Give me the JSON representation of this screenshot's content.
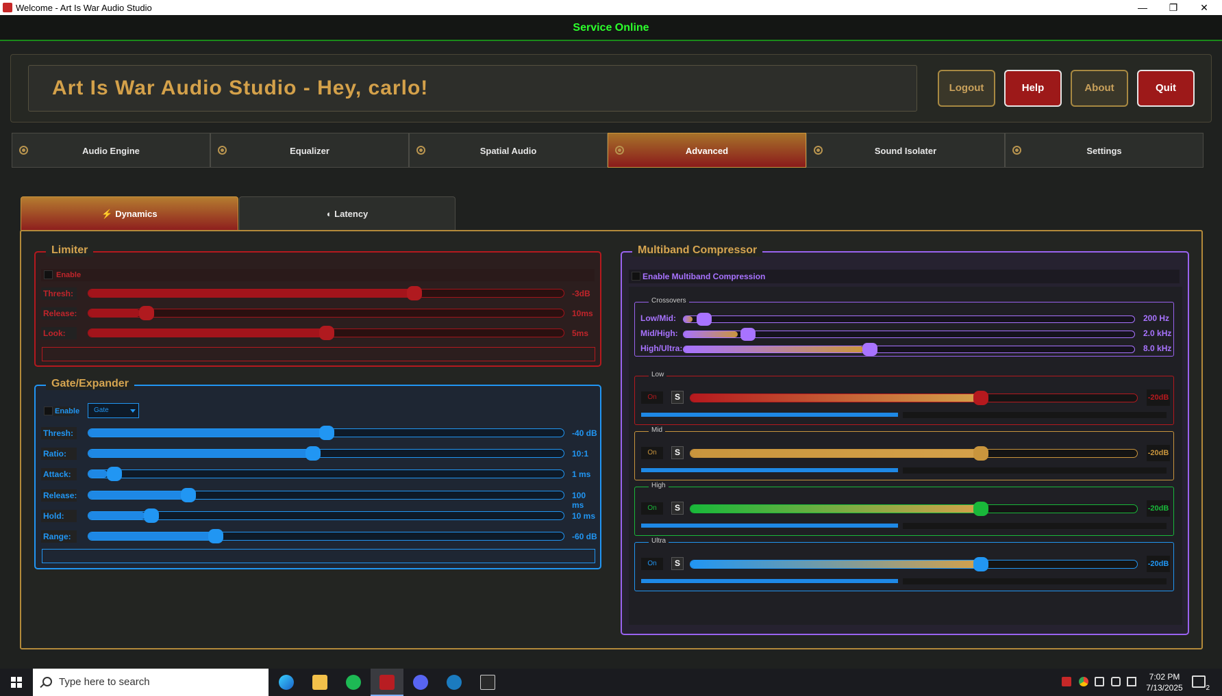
{
  "window": {
    "title": "Welcome - Art Is War Audio Studio",
    "minimize": "—",
    "maximize": "❐",
    "close": "✕"
  },
  "status": "Service Online",
  "header": {
    "title": "Art Is War Audio Studio - Hey, carlo!",
    "logout": "Logout",
    "help": "Help",
    "about": "About",
    "quit": "Quit"
  },
  "tabs": [
    "Audio Engine",
    "Equalizer",
    "Spatial Audio",
    "Advanced",
    "Sound Isolater",
    "Settings"
  ],
  "active_tab": "Advanced",
  "subtabs": {
    "dynamics": "⚡ Dynamics",
    "latency": "◐ Latency"
  },
  "limiter": {
    "title": "Limiter",
    "enable": "Enable",
    "rows": [
      {
        "label": "Thresh:",
        "value": "-3dB",
        "level": 0.69
      },
      {
        "label": "Release:",
        "value": "10ms",
        "level": 0.11
      },
      {
        "label": "Look:",
        "value": "5ms",
        "level": 0.5
      }
    ]
  },
  "gate": {
    "title": "Gate/Expander",
    "enable": "Enable",
    "mode": "Gate",
    "rows": [
      {
        "label": "Thresh:",
        "value": "-40 dB",
        "level": 0.5
      },
      {
        "label": "Ratio:",
        "value": "10:1",
        "level": 0.47
      },
      {
        "label": "Attack:",
        "value": "1 ms",
        "level": 0.04
      },
      {
        "label": "Release:",
        "value": "100 ms",
        "level": 0.2
      },
      {
        "label": "Hold:",
        "value": "10 ms",
        "level": 0.12
      },
      {
        "label": "Range:",
        "value": "-60 dB",
        "level": 0.26
      }
    ]
  },
  "mbc": {
    "title": "Multiband Compressor",
    "enable": "Enable Multiband Compression",
    "crossovers_title": "Crossovers",
    "crossovers": [
      {
        "label": "Low/Mid:",
        "value": "200 Hz",
        "level": 0.02
      },
      {
        "label": "Mid/High:",
        "value": "2.0 kHz",
        "level": 0.12
      },
      {
        "label": "High/Ultra:",
        "value": "8.0 kHz",
        "level": 0.4
      }
    ],
    "bands": [
      {
        "name": "Low",
        "on": "On",
        "solo": "S",
        "value": "-20dB",
        "level": 0.65,
        "color": "#b5191e"
      },
      {
        "name": "Mid",
        "on": "On",
        "solo": "S",
        "value": "-20dB",
        "level": 0.65,
        "color": "#c9953d"
      },
      {
        "name": "High",
        "on": "On",
        "solo": "S",
        "value": "-20dB",
        "level": 0.65,
        "color": "#19b83a"
      },
      {
        "name": "Ultra",
        "on": "On",
        "solo": "S",
        "value": "-20dB",
        "level": 0.65,
        "color": "#2196f3"
      }
    ]
  },
  "taskbar": {
    "search_placeholder": "Type here to search",
    "time": "7:02 PM",
    "date": "7/13/2025",
    "notif_count": "2"
  }
}
